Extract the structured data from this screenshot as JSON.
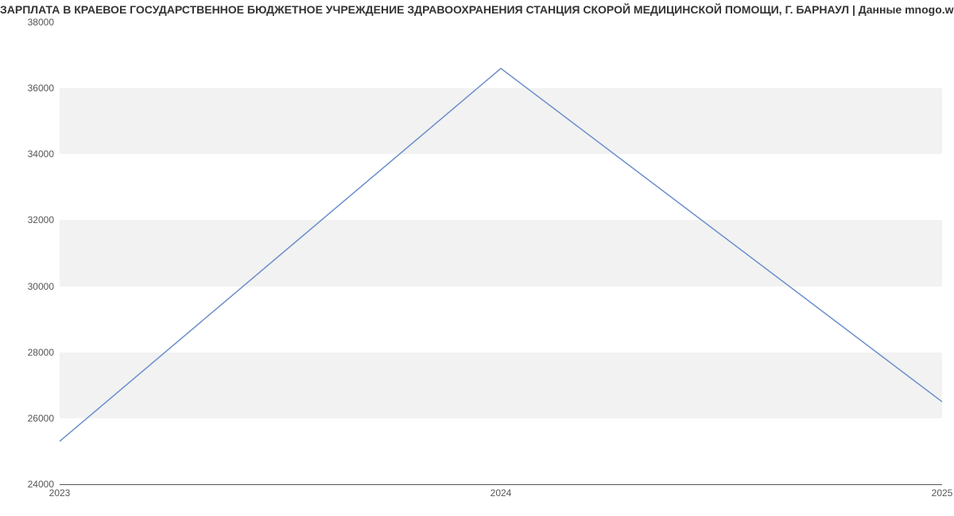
{
  "chart_data": {
    "type": "line",
    "title": "ЗАРПЛАТА В КРАЕВОЕ ГОСУДАРСТВЕННОЕ БЮДЖЕТНОЕ УЧРЕЖДЕНИЕ ЗДРАВООХРАНЕНИЯ СТАНЦИЯ СКОРОЙ МЕДИЦИНСКОЙ ПОМОЩИ, Г. БАРНАУЛ | Данные mnogo.work",
    "xlabel": "",
    "ylabel": "",
    "x": [
      2023,
      2024,
      2025
    ],
    "values": [
      25300,
      36600,
      26500
    ],
    "ylim": [
      24000,
      38000
    ],
    "yticks": [
      24000,
      26000,
      28000,
      30000,
      32000,
      34000,
      36000,
      38000
    ],
    "xticks": [
      2023,
      2024,
      2025
    ],
    "line_color": "#6c8ecb",
    "band_color": "#f2f2f2"
  }
}
